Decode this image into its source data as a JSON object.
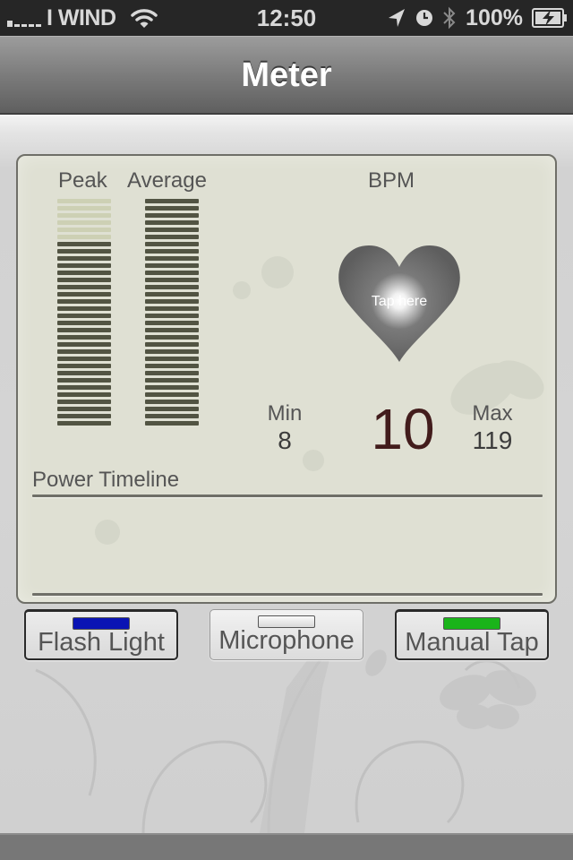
{
  "status_bar": {
    "carrier": "I WIND",
    "time": "12:50",
    "battery_percent": "100%",
    "icons": [
      "signal-icon",
      "wifi-icon",
      "location-arrow-icon",
      "clock-icon",
      "bluetooth-icon",
      "battery-charging-icon"
    ]
  },
  "nav": {
    "title": "Meter"
  },
  "meter": {
    "peak_label": "Peak",
    "average_label": "Average",
    "total_segments": 32,
    "peak_lit_segments": 26,
    "average_lit_segments": 32,
    "colors": {
      "lit": "#525443",
      "unlit": "#cdd0b4"
    }
  },
  "bpm": {
    "title": "BPM",
    "tap_label": "Tap here",
    "value": "10",
    "min_label": "Min",
    "min_value": "8",
    "max_label": "Max",
    "max_value": "119",
    "value_color": "#421c1c"
  },
  "timeline": {
    "title": "Power Timeline"
  },
  "modes": [
    {
      "label": "Flash Light",
      "indicator_color": "#0a14b4",
      "selected": true
    },
    {
      "label": "Microphone",
      "indicator_color": "#e8e8e8",
      "selected": false
    },
    {
      "label": "Manual Tap",
      "indicator_color": "#1ab41a",
      "selected": true
    }
  ]
}
